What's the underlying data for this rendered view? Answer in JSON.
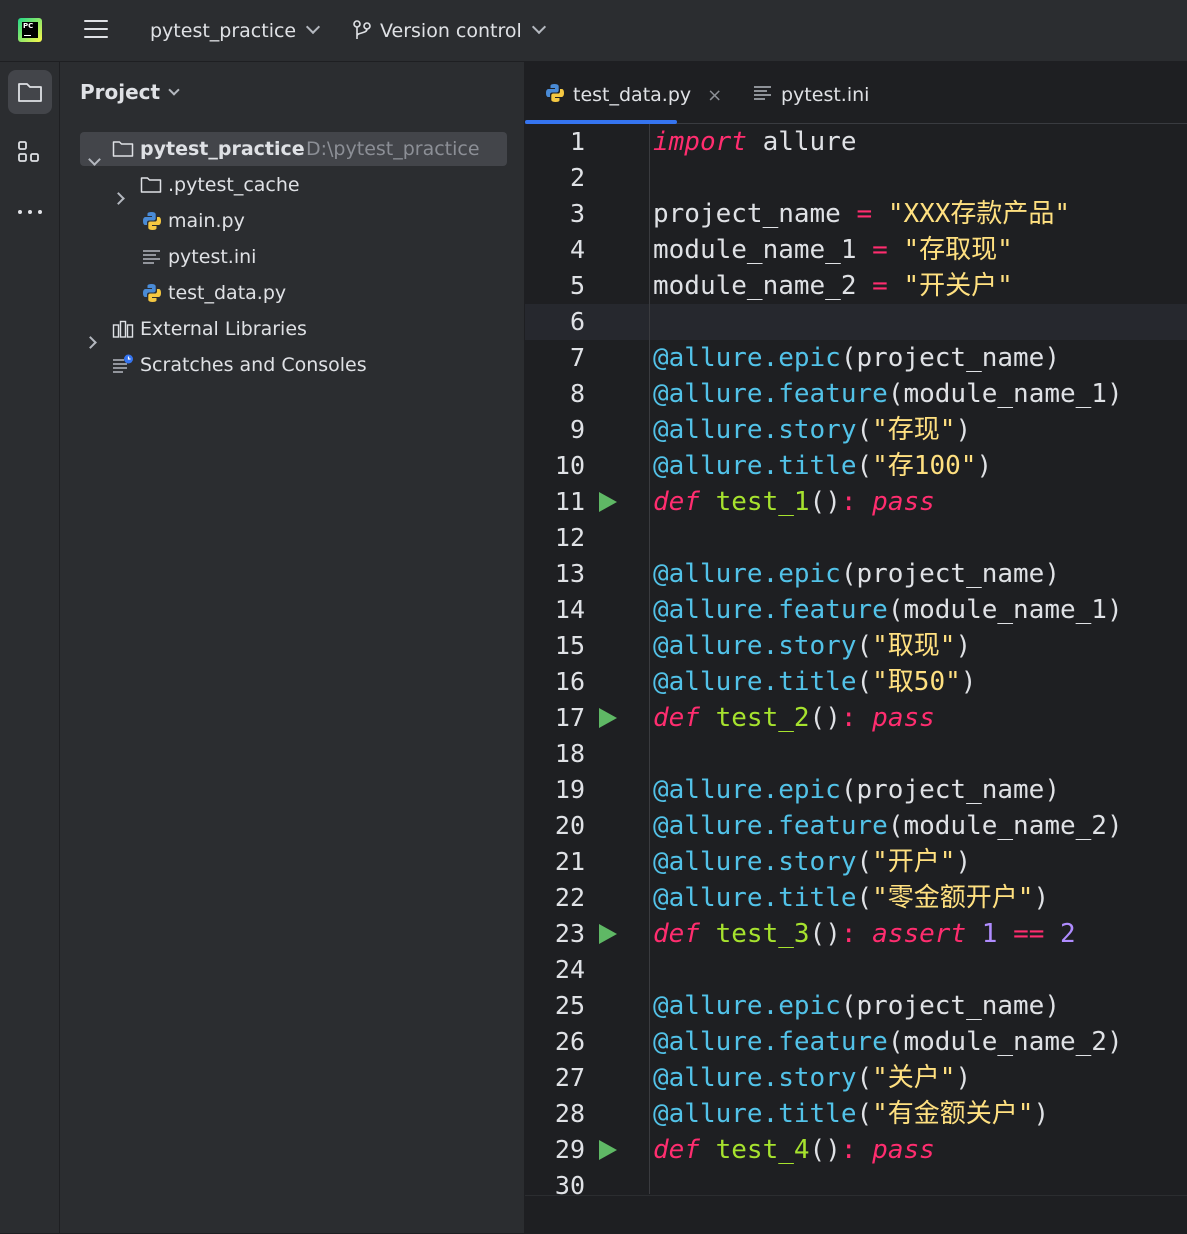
{
  "titlebar": {
    "project_name": "pytest_practice",
    "vcs_label": "Version control"
  },
  "project_panel": {
    "title": "Project",
    "tree": [
      {
        "label": "pytest_practice",
        "path": "D:\\pytest_practice",
        "type": "folder",
        "expanded": true,
        "selected": true
      },
      {
        "label": ".pytest_cache",
        "type": "folder",
        "expanded": false
      },
      {
        "label": "main.py",
        "type": "python-file"
      },
      {
        "label": "pytest.ini",
        "type": "text-file"
      },
      {
        "label": "test_data.py",
        "type": "python-file"
      },
      {
        "label": "External Libraries",
        "type": "library",
        "expanded": false
      },
      {
        "label": "Scratches and Consoles",
        "type": "scratches"
      }
    ]
  },
  "editor": {
    "tabs": [
      {
        "label": "test_data.py",
        "active": true,
        "icon": "python-icon",
        "close": "×"
      },
      {
        "label": "pytest.ini",
        "active": false,
        "icon": "text-file-icon"
      }
    ],
    "current_line": 6,
    "lines": [
      {
        "n": "1",
        "tokens": [
          [
            "kw",
            "import"
          ],
          [
            "p",
            " allure"
          ]
        ]
      },
      {
        "n": "2",
        "tokens": []
      },
      {
        "n": "3",
        "tokens": [
          [
            "p",
            "project_name "
          ],
          [
            "op",
            "="
          ],
          [
            "p",
            " "
          ],
          [
            "str",
            "\"XXX存款产品\""
          ]
        ]
      },
      {
        "n": "4",
        "tokens": [
          [
            "p",
            "module_name_1 "
          ],
          [
            "op",
            "="
          ],
          [
            "p",
            " "
          ],
          [
            "str",
            "\"存取现\""
          ]
        ]
      },
      {
        "n": "5",
        "tokens": [
          [
            "p",
            "module_name_2 "
          ],
          [
            "op",
            "="
          ],
          [
            "p",
            " "
          ],
          [
            "str",
            "\"开关户\""
          ]
        ]
      },
      {
        "n": "6",
        "tokens": []
      },
      {
        "n": "7",
        "tokens": [
          [
            "dec",
            "@allure.epic"
          ],
          [
            "p",
            "(project_name)"
          ]
        ]
      },
      {
        "n": "8",
        "tokens": [
          [
            "dec",
            "@allure.feature"
          ],
          [
            "p",
            "(module_name_1)"
          ]
        ]
      },
      {
        "n": "9",
        "tokens": [
          [
            "dec",
            "@allure.story"
          ],
          [
            "p",
            "("
          ],
          [
            "str",
            "\"存现\""
          ],
          [
            "p",
            ")"
          ]
        ]
      },
      {
        "n": "10",
        "tokens": [
          [
            "dec",
            "@allure.title"
          ],
          [
            "p",
            "("
          ],
          [
            "str",
            "\"存100\""
          ],
          [
            "p",
            ")"
          ]
        ]
      },
      {
        "n": "11",
        "run": true,
        "tokens": [
          [
            "kw",
            "def"
          ],
          [
            "p",
            " "
          ],
          [
            "fn",
            "test_1"
          ],
          [
            "p",
            "()"
          ],
          [
            "op",
            ":"
          ],
          [
            "p",
            " "
          ],
          [
            "kw",
            "pass"
          ]
        ]
      },
      {
        "n": "12",
        "tokens": []
      },
      {
        "n": "13",
        "tokens": [
          [
            "dec",
            "@allure.epic"
          ],
          [
            "p",
            "(project_name)"
          ]
        ]
      },
      {
        "n": "14",
        "tokens": [
          [
            "dec",
            "@allure.feature"
          ],
          [
            "p",
            "(module_name_1)"
          ]
        ]
      },
      {
        "n": "15",
        "tokens": [
          [
            "dec",
            "@allure.story"
          ],
          [
            "p",
            "("
          ],
          [
            "str",
            "\"取现\""
          ],
          [
            "p",
            ")"
          ]
        ]
      },
      {
        "n": "16",
        "tokens": [
          [
            "dec",
            "@allure.title"
          ],
          [
            "p",
            "("
          ],
          [
            "str",
            "\"取50\""
          ],
          [
            "p",
            ")"
          ]
        ]
      },
      {
        "n": "17",
        "run": true,
        "tokens": [
          [
            "kw",
            "def"
          ],
          [
            "p",
            " "
          ],
          [
            "fn",
            "test_2"
          ],
          [
            "p",
            "()"
          ],
          [
            "op",
            ":"
          ],
          [
            "p",
            " "
          ],
          [
            "kw",
            "pass"
          ]
        ]
      },
      {
        "n": "18",
        "tokens": []
      },
      {
        "n": "19",
        "tokens": [
          [
            "dec",
            "@allure.epic"
          ],
          [
            "p",
            "(project_name)"
          ]
        ]
      },
      {
        "n": "20",
        "tokens": [
          [
            "dec",
            "@allure.feature"
          ],
          [
            "p",
            "(module_name_2)"
          ]
        ]
      },
      {
        "n": "21",
        "tokens": [
          [
            "dec",
            "@allure.story"
          ],
          [
            "p",
            "("
          ],
          [
            "str",
            "\"开户\""
          ],
          [
            "p",
            ")"
          ]
        ]
      },
      {
        "n": "22",
        "tokens": [
          [
            "dec",
            "@allure.title"
          ],
          [
            "p",
            "("
          ],
          [
            "str",
            "\"零金额开户\""
          ],
          [
            "p",
            ")"
          ]
        ]
      },
      {
        "n": "23",
        "run": true,
        "tokens": [
          [
            "kw",
            "def"
          ],
          [
            "p",
            " "
          ],
          [
            "fn",
            "test_3"
          ],
          [
            "p",
            "()"
          ],
          [
            "op",
            ":"
          ],
          [
            "p",
            " "
          ],
          [
            "kw",
            "assert"
          ],
          [
            "p",
            " "
          ],
          [
            "num",
            "1"
          ],
          [
            "p",
            " "
          ],
          [
            "op",
            "=="
          ],
          [
            "p",
            " "
          ],
          [
            "num",
            "2"
          ]
        ]
      },
      {
        "n": "24",
        "tokens": []
      },
      {
        "n": "25",
        "tokens": [
          [
            "dec",
            "@allure.epic"
          ],
          [
            "p",
            "(project_name)"
          ]
        ]
      },
      {
        "n": "26",
        "tokens": [
          [
            "dec",
            "@allure.feature"
          ],
          [
            "p",
            "(module_name_2)"
          ]
        ]
      },
      {
        "n": "27",
        "tokens": [
          [
            "dec",
            "@allure.story"
          ],
          [
            "p",
            "("
          ],
          [
            "str",
            "\"关户\""
          ],
          [
            "p",
            ")"
          ]
        ]
      },
      {
        "n": "28",
        "tokens": [
          [
            "dec",
            "@allure.title"
          ],
          [
            "p",
            "("
          ],
          [
            "str",
            "\"有金额关户\""
          ],
          [
            "p",
            ")"
          ]
        ]
      },
      {
        "n": "29",
        "run": true,
        "tokens": [
          [
            "kw",
            "def"
          ],
          [
            "p",
            " "
          ],
          [
            "fn",
            "test_4"
          ],
          [
            "p",
            "()"
          ],
          [
            "op",
            ":"
          ],
          [
            "p",
            " "
          ],
          [
            "kw",
            "pass"
          ]
        ]
      },
      {
        "n": "30",
        "tokens": []
      }
    ]
  },
  "colors": {
    "keyword": "#ff2d6f",
    "string": "#ffe080",
    "decorator": "#52c2e8",
    "function": "#a6e22e",
    "number": "#b08cff",
    "run_marker": "#5fb865",
    "accent": "#3574f0"
  }
}
